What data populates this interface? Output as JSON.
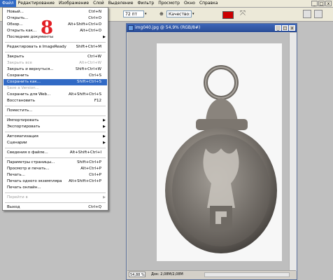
{
  "menubar": {
    "items": [
      "Файл",
      "Редактирование",
      "Изображение",
      "Слой",
      "Выделение",
      "Фильтр",
      "Просмотр",
      "Окно",
      "Справка"
    ],
    "window_buttons": [
      "_",
      "□",
      "x"
    ]
  },
  "options": {
    "resolution": "72 пт",
    "mode_label": "Качество:"
  },
  "annotation": "8",
  "file_menu": [
    {
      "label": "Новый...",
      "shortcut": "Ctrl+N",
      "state": "normal"
    },
    {
      "label": "Открыть...",
      "shortcut": "Ctrl+O",
      "state": "normal"
    },
    {
      "label": "Обзор...",
      "shortcut": "Alt+Shift+Ctrl+O",
      "state": "normal"
    },
    {
      "label": "Открыть как...",
      "shortcut": "Alt+Ctrl+O",
      "state": "normal"
    },
    {
      "label": "Последние документы",
      "shortcut": "",
      "state": "submenu"
    },
    {
      "sep": true
    },
    {
      "label": "Редактировать в ImageReady",
      "shortcut": "Shift+Ctrl+M",
      "state": "normal"
    },
    {
      "sep": true
    },
    {
      "label": "Закрыть",
      "shortcut": "Ctrl+W",
      "state": "normal"
    },
    {
      "label": "Закрыть все",
      "shortcut": "Alt+Ctrl+W",
      "state": "disabled"
    },
    {
      "label": "Закрыть и вернуться...",
      "shortcut": "Shift+Ctrl+W",
      "state": "normal"
    },
    {
      "label": "Сохранить",
      "shortcut": "Ctrl+S",
      "state": "normal"
    },
    {
      "label": "Сохранить как...",
      "shortcut": "Shift+Ctrl+S",
      "state": "highlighted"
    },
    {
      "label": "Save a Version...",
      "shortcut": "",
      "state": "disabled"
    },
    {
      "label": "Сохранить для Web...",
      "shortcut": "Alt+Shift+Ctrl+S",
      "state": "normal"
    },
    {
      "label": "Восстановить",
      "shortcut": "F12",
      "state": "normal"
    },
    {
      "sep": true
    },
    {
      "label": "Поместить...",
      "shortcut": "",
      "state": "normal"
    },
    {
      "sep": true
    },
    {
      "label": "Импортировать",
      "shortcut": "",
      "state": "submenu"
    },
    {
      "label": "Экспортировать",
      "shortcut": "",
      "state": "submenu"
    },
    {
      "sep": true
    },
    {
      "label": "Автоматизация",
      "shortcut": "",
      "state": "submenu"
    },
    {
      "label": "Сценарии",
      "shortcut": "",
      "state": "submenu"
    },
    {
      "sep": true
    },
    {
      "label": "Сведения о файле...",
      "shortcut": "Alt+Shift+Ctrl+I",
      "state": "normal"
    },
    {
      "sep": true
    },
    {
      "label": "Параметры страницы...",
      "shortcut": "Shift+Ctrl+P",
      "state": "normal"
    },
    {
      "label": "Просмотр и печать...",
      "shortcut": "Alt+Ctrl+P",
      "state": "normal"
    },
    {
      "label": "Печать...",
      "shortcut": "Ctrl+P",
      "state": "normal"
    },
    {
      "label": "Печать одного экземпляра",
      "shortcut": "Alt+Shift+Ctrl+P",
      "state": "normal"
    },
    {
      "label": "Печать онлайн...",
      "shortcut": "",
      "state": "normal"
    },
    {
      "sep": true
    },
    {
      "label": "Перейти в",
      "shortcut": "",
      "state": "disabled-submenu"
    },
    {
      "sep": true
    },
    {
      "label": "Выход",
      "shortcut": "Ctrl+Q",
      "state": "normal"
    }
  ],
  "document": {
    "title": "img040.jpg @ 54,9% (RGB/8#)",
    "zoom": "54,88 %",
    "doc_info": "Док: 2,08M/2,08M"
  }
}
